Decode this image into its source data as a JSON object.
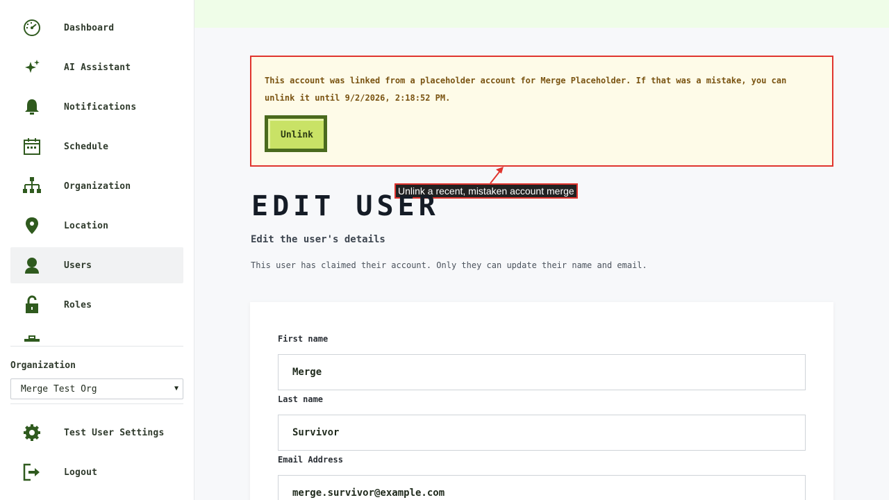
{
  "sidebar": {
    "items": [
      {
        "label": "Dashboard",
        "icon": "dashboard-icon"
      },
      {
        "label": "AI Assistant",
        "icon": "sparkle-icon"
      },
      {
        "label": "Notifications",
        "icon": "bell-icon"
      },
      {
        "label": "Schedule",
        "icon": "calendar-icon"
      },
      {
        "label": "Organization",
        "icon": "org-chart-icon"
      },
      {
        "label": "Location",
        "icon": "map-pin-icon"
      },
      {
        "label": "Users",
        "icon": "user-icon",
        "active": true
      },
      {
        "label": "Roles",
        "icon": "lock-icon"
      }
    ],
    "org_label": "Organization",
    "org_selected": "Merge Test Org",
    "bottom_items": [
      {
        "label": "Test User Settings",
        "icon": "gear-icon"
      },
      {
        "label": "Logout",
        "icon": "logout-icon"
      }
    ]
  },
  "alert": {
    "message": "This account was linked from a placeholder account for Merge Placeholder. If that was a mistake, you can unlink it until 9/2/2026, 2:18:52 PM.",
    "unlink_label": "Unlink"
  },
  "tooltip": "Unlink a recent, mistaken account merge",
  "page": {
    "title": "EDIT USER",
    "subtitle": "Edit the user's details",
    "note": "This user has claimed their account. Only they can update their name and email."
  },
  "form": {
    "first_name_label": "First name",
    "first_name_value": "Merge",
    "last_name_label": "Last name",
    "last_name_value": "Survivor",
    "email_label": "Email Address",
    "email_value": "merge.survivor@example.com"
  },
  "colors": {
    "icon_green": "#2f5a1e",
    "alert_border": "#e0342e",
    "alert_bg": "#fefbe8",
    "topbar_bg": "#effde8",
    "button_green": "#c9e266"
  }
}
